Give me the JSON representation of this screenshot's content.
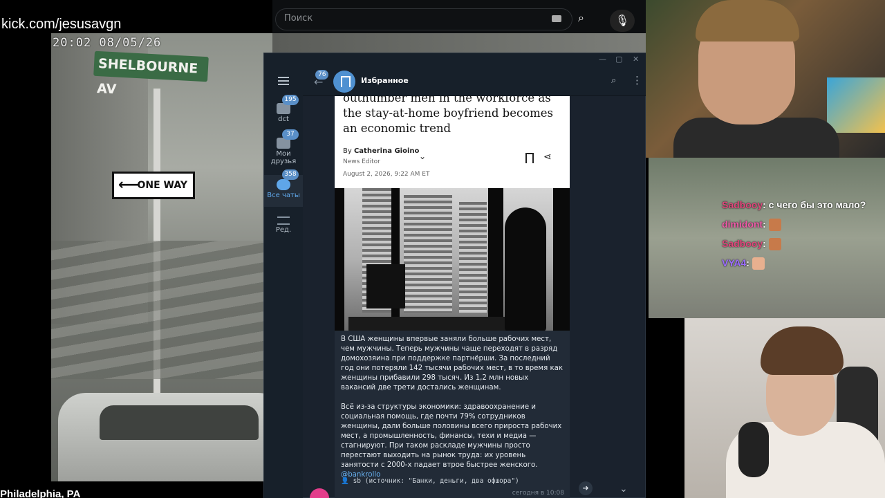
{
  "stream": {
    "url": "kick.com/jesusavgn",
    "timestamp": "20:02 08/05/26",
    "location": "Philadelphia, PA",
    "signs": {
      "street": "SHELBOURNE AV",
      "oneway": "ONE WAY"
    }
  },
  "browser": {
    "search_placeholder": "Поиск"
  },
  "telegram": {
    "folders": [
      {
        "label": "dct",
        "badge": "195"
      },
      {
        "label": "Мои друзья",
        "badge": "37"
      },
      {
        "label": "Все чаты",
        "badge": "358"
      },
      {
        "label": "Ред.",
        "badge": ""
      }
    ],
    "header": {
      "back_badge": "76",
      "title": "Избранное"
    },
    "article": {
      "title": "outnumber men in the workforce as the stay-at-home boyfriend becomes an economic trend",
      "by": "By",
      "author": "Catherina Gioino",
      "role": "News Editor",
      "date": "August 2, 2026, 9:22 AM ET"
    },
    "message": {
      "para1": "В США женщины впервые заняли больше рабочих мест, чем мужчины. Теперь мужчины чаще переходят в разряд домохозяина при поддержке партнёрши. За последний год они потеряли 142 тысячи рабочих мест, в то время как женщины прибавили 298 тысяч. Из 1,2 млн новых вакансий две трети достались женщинам.",
      "para2": "Всё из-за структуры экономики: здравоохранение и социальная помощь, где почти 79% сотрудников женщины, дали больше половины всего прироста рабочих мест, а промышленность, финансы, техи и медиа — стагнируют. При таком раскладе мужчины просто перестают выходить на рынок труда: их уровень занятости с 2000-х падает втрое быстрее женского.",
      "link": "@bankrollo",
      "signature": "sb (источник: \"Банки, деньги, два офшора\")",
      "time": "сегодня в 10:08"
    }
  },
  "chat_overlay": [
    {
      "user": "Sadbooy",
      "text": ": с чего бы это мало?"
    },
    {
      "user": "dimidont",
      "text": ":"
    },
    {
      "user": "Sadbooy",
      "text": ":"
    },
    {
      "user": "VYA4",
      "text": ":"
    }
  ]
}
